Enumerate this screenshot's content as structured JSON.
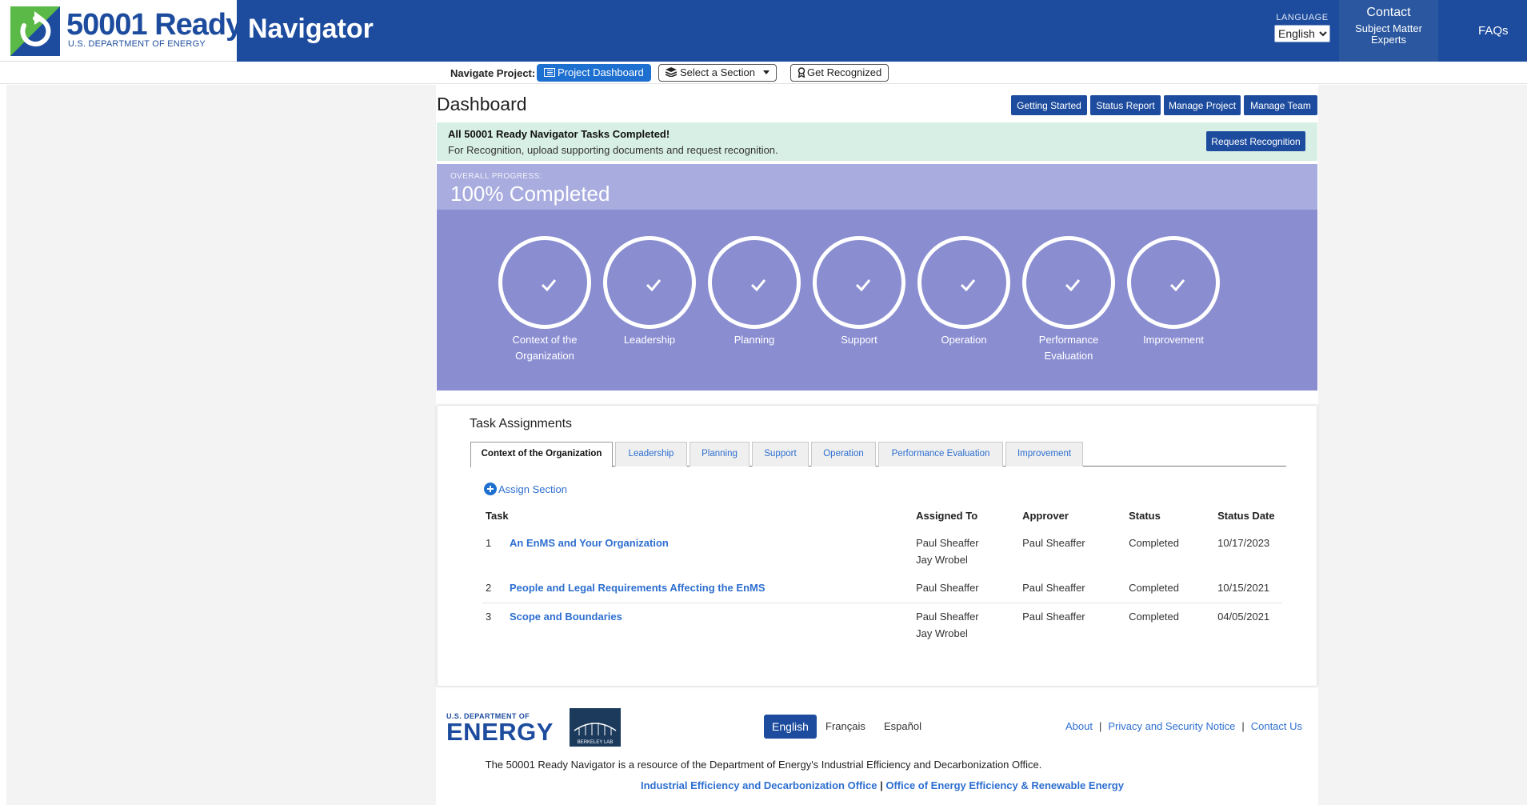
{
  "header": {
    "logo_title": "50001 Ready",
    "logo_subtitle": "U.S. DEPARTMENT OF ENERGY",
    "app_name": "Navigator",
    "language_label": "LANGUAGE",
    "language_value": "English",
    "contact_title": "Contact",
    "contact_sub": "Subject Matter Experts",
    "faqs": "FAQs",
    "brand_color": "#1d4c9e",
    "logo_icon": "refresh-arrow-icon"
  },
  "nav": {
    "label": "Navigate Project:",
    "dashboard": "Project Dashboard",
    "select_section": "Select a Section",
    "get_recognized": "Get Recognized"
  },
  "dashboard": {
    "title": "Dashboard",
    "buttons": {
      "getting_started": "Getting Started",
      "status_report": "Status Report",
      "manage_project": "Manage Project",
      "manage_team": "Manage Team"
    }
  },
  "alert": {
    "title": "All 50001 Ready Navigator Tasks Completed!",
    "text": "For Recognition, upload supporting documents and request recognition.",
    "button": "Request Recognition"
  },
  "progress": {
    "label": "OVERALL PROGRESS:",
    "value": "100% Completed",
    "percent": 100,
    "sections": [
      {
        "label": "Context of the Organization",
        "completed": true
      },
      {
        "label": "Leadership",
        "completed": true
      },
      {
        "label": "Planning",
        "completed": true
      },
      {
        "label": "Support",
        "completed": true
      },
      {
        "label": "Operation",
        "completed": true
      },
      {
        "label": "Performance Evaluation",
        "completed": true
      },
      {
        "label": "Improvement",
        "completed": true
      }
    ]
  },
  "tasks": {
    "title": "Task Assignments",
    "tabs": [
      "Context of the Organization",
      "Leadership",
      "Planning",
      "Support",
      "Operation",
      "Performance Evaluation",
      "Improvement"
    ],
    "active_tab": "Context of the Organization",
    "assign_section": "Assign Section",
    "columns": {
      "task": "Task",
      "assigned_to": "Assigned To",
      "approver": "Approver",
      "status": "Status",
      "status_date": "Status Date"
    },
    "rows": [
      {
        "num": "1",
        "name": "An EnMS and Your Organization",
        "assigned_to": [
          "Paul Sheaffer",
          "Jay Wrobel"
        ],
        "approver": "Paul Sheaffer",
        "status": "Completed",
        "date": "10/17/2023"
      },
      {
        "num": "2",
        "name": "People and Legal Requirements Affecting the EnMS",
        "assigned_to": [
          "Paul Sheaffer"
        ],
        "approver": "Paul Sheaffer",
        "status": "Completed",
        "date": "10/15/2021"
      },
      {
        "num": "3",
        "name": "Scope and Boundaries",
        "assigned_to": [
          "Paul Sheaffer",
          "Jay Wrobel"
        ],
        "approver": "Paul Sheaffer",
        "status": "Completed",
        "date": "04/05/2021"
      }
    ]
  },
  "footer": {
    "doe_small": "U.S. DEPARTMENT OF",
    "doe_big": "ENERGY",
    "berkeley_text": "BERKELEY LAB",
    "languages": {
      "english": "English",
      "francais": "Français",
      "espanol": "Español"
    },
    "links": {
      "about": "About",
      "privacy": "Privacy and Security Notice",
      "contact": "Contact Us"
    },
    "resource_text": "The 50001 Ready Navigator is a resource of the Department of Energy's Industrial Efficiency and Decarbonization Office.",
    "office1": "Industrial Efficiency and Decarbonization Office",
    "office2": "Office of Energy Efficiency & Renewable Energy"
  }
}
